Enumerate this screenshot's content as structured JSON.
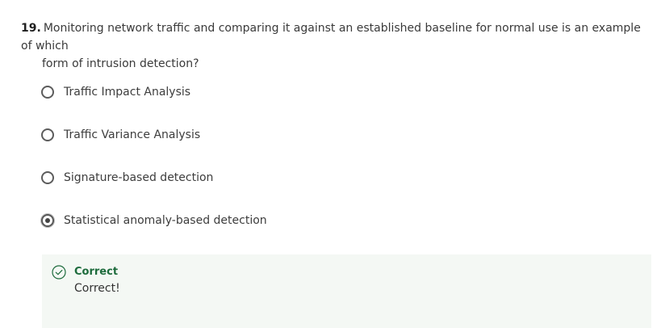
{
  "question": {
    "number": "19.",
    "text_line1": "Monitoring network traffic and comparing it against an established baseline for normal use is an example of which",
    "text_line2": "form of intrusion detection?"
  },
  "options": [
    {
      "label": "Traffic Impact Analysis",
      "selected": false
    },
    {
      "label": "Traffic Variance Analysis",
      "selected": false
    },
    {
      "label": "Signature-based detection",
      "selected": false
    },
    {
      "label": "Statistical anomaly-based detection",
      "selected": true
    }
  ],
  "feedback": {
    "status": "Correct",
    "message": "Correct!",
    "icon": "check-circle-icon",
    "accent_color": "#1d6b3c",
    "background_color": "#f4f8f4"
  }
}
